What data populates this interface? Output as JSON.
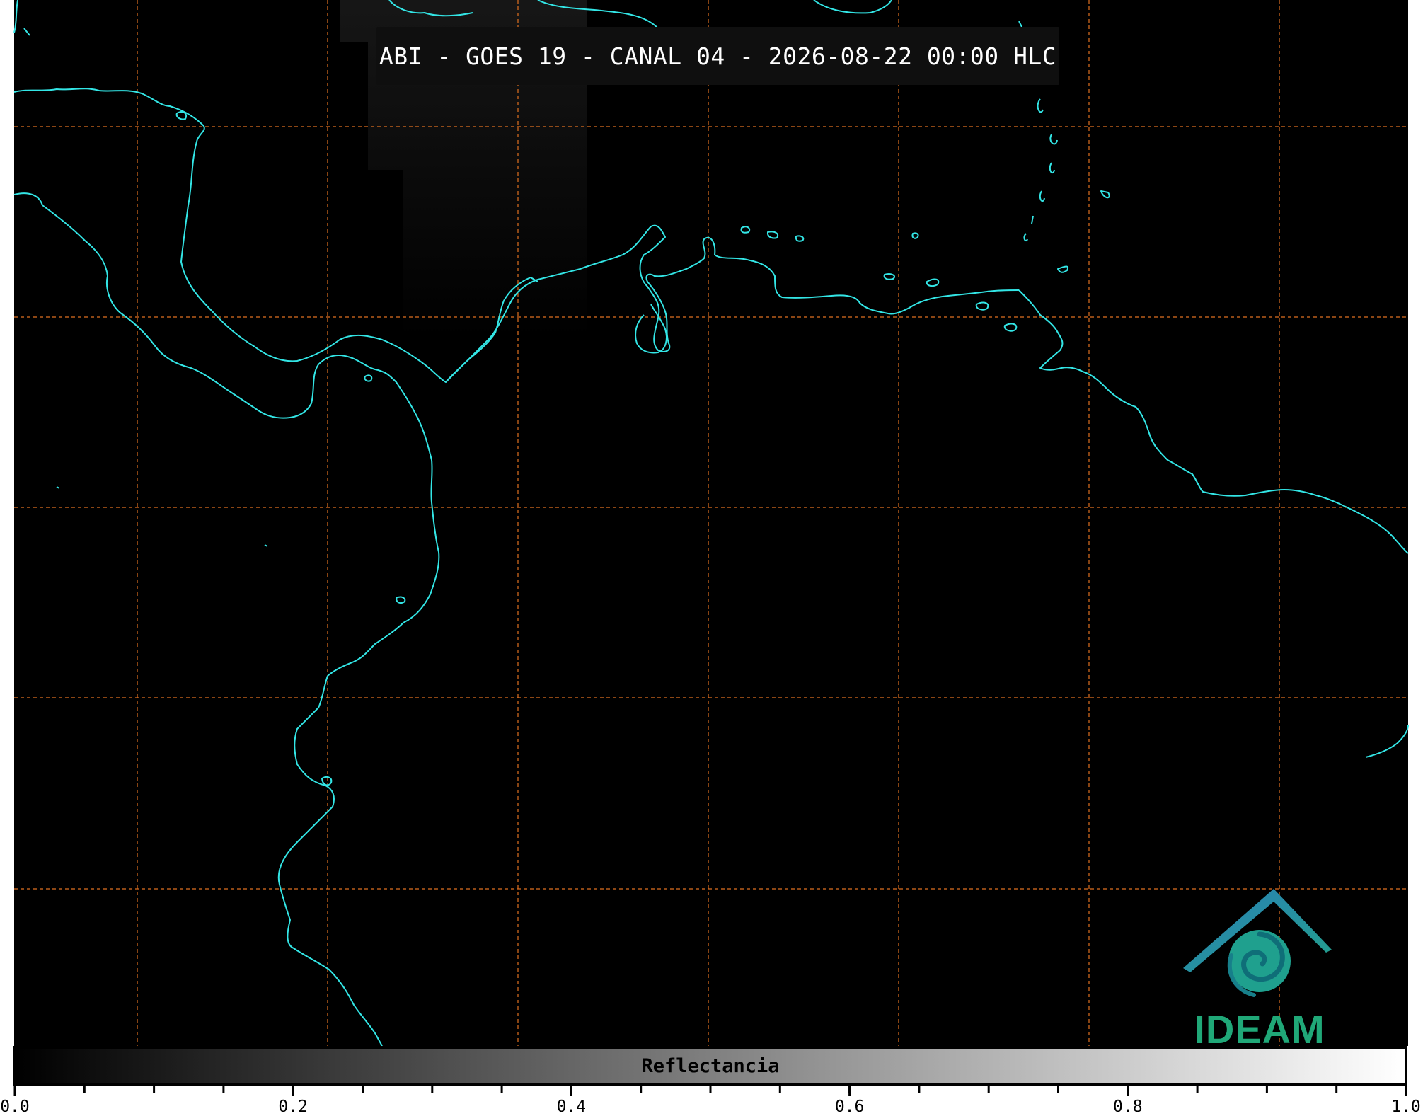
{
  "map": {
    "title": "ABI - GOES 19 - CANAL 04 - 2026-08-22 00:00 HLC",
    "background_color": "#000000",
    "coastline_color": "#33e6e6",
    "gridline_color": "#e07020",
    "gridline_style": "dashed"
  },
  "logo": {
    "text": "IDEAM",
    "text_color": "#20a878",
    "roof_color": "#2a7fb8",
    "swirl_color": "#1fa08e"
  },
  "colorbar": {
    "label": "Reflectancia",
    "min": 0.0,
    "max": 1.0,
    "colors": [
      "#000000",
      "#ffffff"
    ],
    "major_ticks": [
      {
        "value": 0.0,
        "label": "0.0"
      },
      {
        "value": 0.2,
        "label": "0.2"
      },
      {
        "value": 0.4,
        "label": "0.4"
      },
      {
        "value": 0.6,
        "label": "0.6"
      },
      {
        "value": 0.8,
        "label": "0.8"
      },
      {
        "value": 1.0,
        "label": "1.0"
      }
    ],
    "minor_tick_step": 0.05
  }
}
